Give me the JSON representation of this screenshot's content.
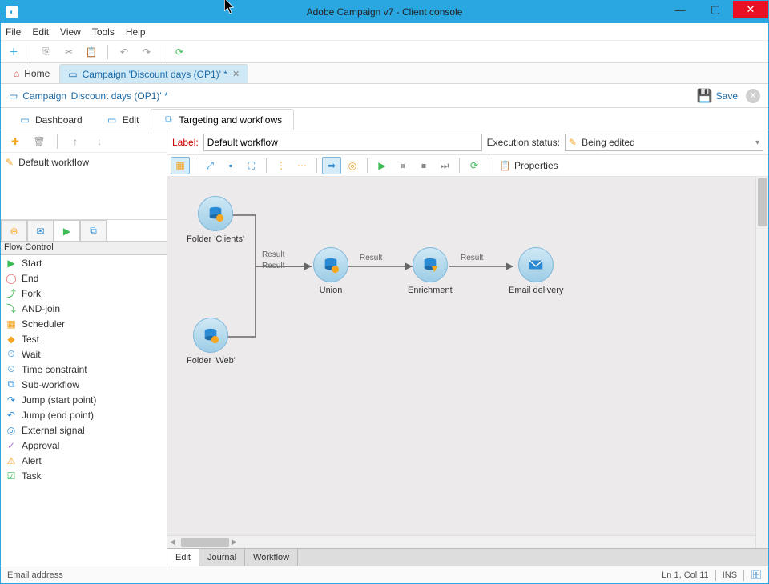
{
  "titlebar": {
    "title": "Adobe Campaign v7 - Client console"
  },
  "menubar": [
    "File",
    "Edit",
    "View",
    "Tools",
    "Help"
  ],
  "tabs_top": {
    "home": "Home",
    "active": "Campaign 'Discount days (OP1)' *"
  },
  "breadcrumb": {
    "text": "Campaign 'Discount days (OP1)' *",
    "save": "Save"
  },
  "sub_tabs": [
    {
      "label": "Dashboard",
      "active": false
    },
    {
      "label": "Edit",
      "active": false
    },
    {
      "label": "Targeting and workflows",
      "active": true
    }
  ],
  "label_row": {
    "label_caption": "Label:",
    "label_value": "Default workflow",
    "status_caption": "Execution status:",
    "status_value": "Being edited"
  },
  "canvas_toolbar": {
    "properties": "Properties"
  },
  "wf_list": [
    "Default workflow"
  ],
  "palette_header": "Flow Control",
  "palette": [
    {
      "icon": "start-icon",
      "color": "#3cba54",
      "glyph": "▶",
      "label": "Start"
    },
    {
      "icon": "end-icon",
      "color": "#e46a6a",
      "glyph": "◯",
      "label": "End"
    },
    {
      "icon": "fork-icon",
      "color": "#3cba54",
      "glyph": "⤴",
      "label": "Fork"
    },
    {
      "icon": "and-join-icon",
      "color": "#3cba54",
      "glyph": "⤵",
      "label": "AND-join"
    },
    {
      "icon": "scheduler-icon",
      "color": "#f5a623",
      "glyph": "▦",
      "label": "Scheduler"
    },
    {
      "icon": "test-icon",
      "color": "#f5a623",
      "glyph": "◆",
      "label": "Test"
    },
    {
      "icon": "wait-icon",
      "color": "#2a8ad4",
      "glyph": "⏱",
      "label": "Wait"
    },
    {
      "icon": "time-constraint-icon",
      "color": "#2a8ad4",
      "glyph": "⏲",
      "label": "Time constraint"
    },
    {
      "icon": "sub-workflow-icon",
      "color": "#2a8ad4",
      "glyph": "⧉",
      "label": "Sub-workflow"
    },
    {
      "icon": "jump-start-icon",
      "color": "#2a8ad4",
      "glyph": "↷",
      "label": "Jump (start point)"
    },
    {
      "icon": "jump-end-icon",
      "color": "#2a8ad4",
      "glyph": "↶",
      "label": "Jump (end point)"
    },
    {
      "icon": "external-signal-icon",
      "color": "#2a8ad4",
      "glyph": "◎",
      "label": "External signal"
    },
    {
      "icon": "approval-icon",
      "color": "#b078d6",
      "glyph": "✓",
      "label": "Approval"
    },
    {
      "icon": "alert-icon",
      "color": "#f5a623",
      "glyph": "⚠",
      "label": "Alert"
    },
    {
      "icon": "task-icon",
      "color": "#3cba54",
      "glyph": "☑",
      "label": "Task"
    }
  ],
  "nodes": {
    "clients": "Folder 'Clients'",
    "web": "Folder 'Web'",
    "union": "Union",
    "enrichment": "Enrichment",
    "email": "Email delivery"
  },
  "edge_labels": {
    "result1": "Result",
    "result2": "Result",
    "result3": "Result",
    "result4": "Result"
  },
  "wf_bottom_tabs": [
    "Edit",
    "Journal",
    "Workflow"
  ],
  "statusbar": {
    "left": "Email address",
    "pos": "Ln 1, Col 11",
    "ins": "INS"
  }
}
